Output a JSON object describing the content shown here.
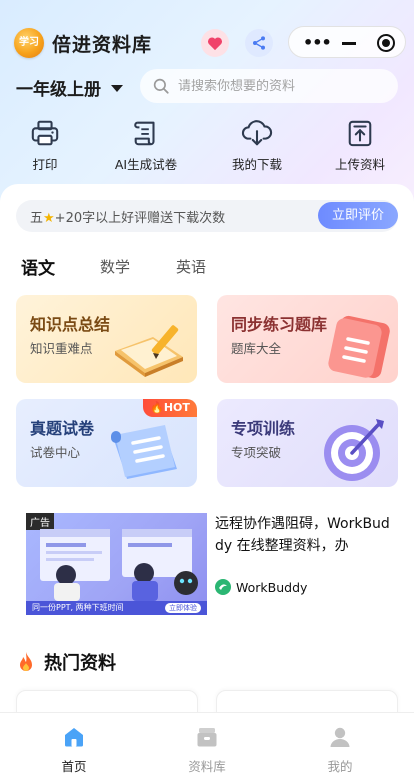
{
  "header": {
    "logo_text": "学习",
    "app_title": "倍进资料库"
  },
  "filter": {
    "grade": "一年级上册",
    "search_placeholder": "请搜索你想要的资料"
  },
  "quick_actions": [
    {
      "label": "打印",
      "icon": "printer-icon"
    },
    {
      "label": "AI生成试卷",
      "icon": "scroll-icon"
    },
    {
      "label": "我的下载",
      "icon": "cloud-download-icon"
    },
    {
      "label": "上传资料",
      "icon": "upload-icon"
    }
  ],
  "review_banner": {
    "text_prefix": "五",
    "text_suffix": "+20字以上好评赠送下载次数",
    "button": "立即评价"
  },
  "subject_tabs": [
    "语文",
    "数学",
    "英语"
  ],
  "tiles": [
    {
      "title": "知识点总结",
      "subtitle": "知识重难点"
    },
    {
      "title": "同步练习题库",
      "subtitle": "题库大全"
    },
    {
      "title": "真题试卷",
      "subtitle": "试卷中心",
      "badge": "HOT"
    },
    {
      "title": "专项训练",
      "subtitle": "专项突破"
    }
  ],
  "ad": {
    "tag": "广告",
    "strip_text": "同一份PPT, 两种下班时间",
    "strip_button": "立即体验",
    "text": "远程协作遇阻碍，WorkBuddy 在线整理资料，办",
    "brand": "WorkBuddy"
  },
  "hot_section": {
    "title": "热门资料"
  },
  "tabbar": [
    {
      "label": "首页",
      "icon": "home-icon",
      "active": true
    },
    {
      "label": "资料库",
      "icon": "archive-icon",
      "active": false
    },
    {
      "label": "我的",
      "icon": "profile-icon",
      "active": false
    }
  ],
  "colors": {
    "accent": "#6e8bff",
    "tab_active_text": "#222222",
    "tab_inactive_text": "#999999",
    "hot_badge": "#ff4d3a"
  }
}
